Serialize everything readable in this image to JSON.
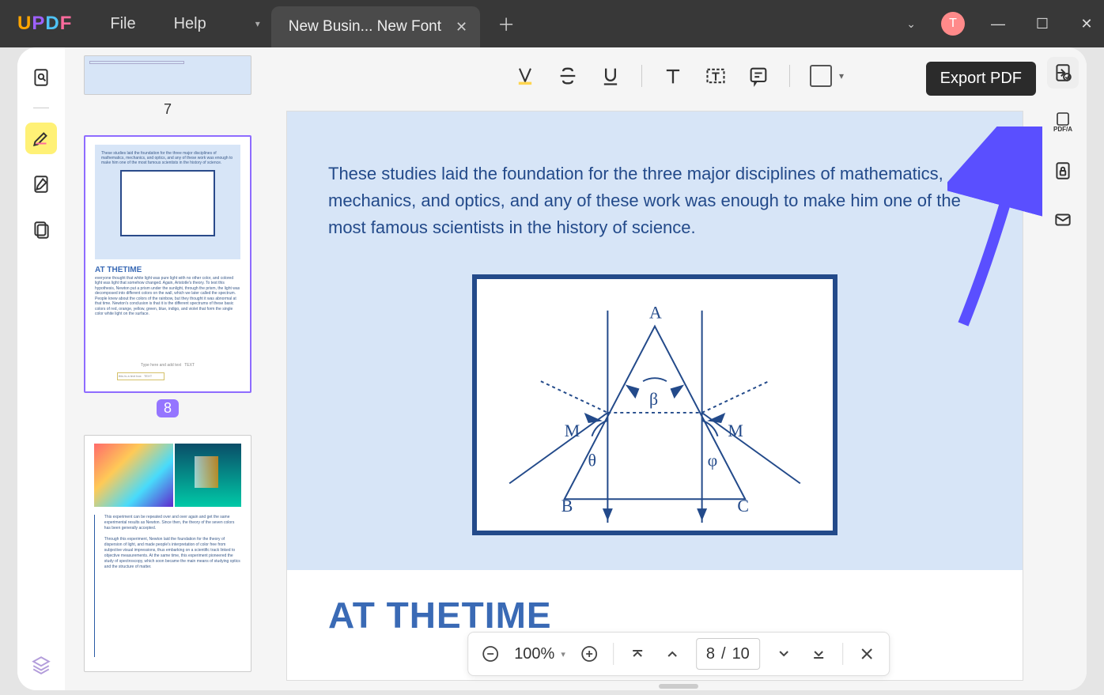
{
  "app": {
    "logo_chars": [
      "U",
      "P",
      "D",
      "F"
    ]
  },
  "menu": {
    "file": "File",
    "help": "Help"
  },
  "tab": {
    "title": "New Busin... New Font",
    "avatar_letter": "T"
  },
  "thumbnails": {
    "p7": "7",
    "p8": "8",
    "p8_title": "AT THETIME"
  },
  "tooltip": {
    "export_pdf": "Export PDF"
  },
  "right_tools": {
    "pdfa_label": "PDF/A"
  },
  "page": {
    "paragraph": "These studies laid the foundation for the three major disciplines of mathematics, mechanics, and optics, and any of these work was enough to make him one of the most famous scientists in the history of science.",
    "heading": "AT THETIME",
    "diagram": {
      "A": "A",
      "B": "B",
      "C": "C",
      "M1": "M",
      "M2": "M",
      "theta": "θ",
      "phi": "φ",
      "beta": "β"
    }
  },
  "bottombar": {
    "zoom": "100%",
    "page_current": "8",
    "page_sep": "/",
    "page_total": "10"
  }
}
